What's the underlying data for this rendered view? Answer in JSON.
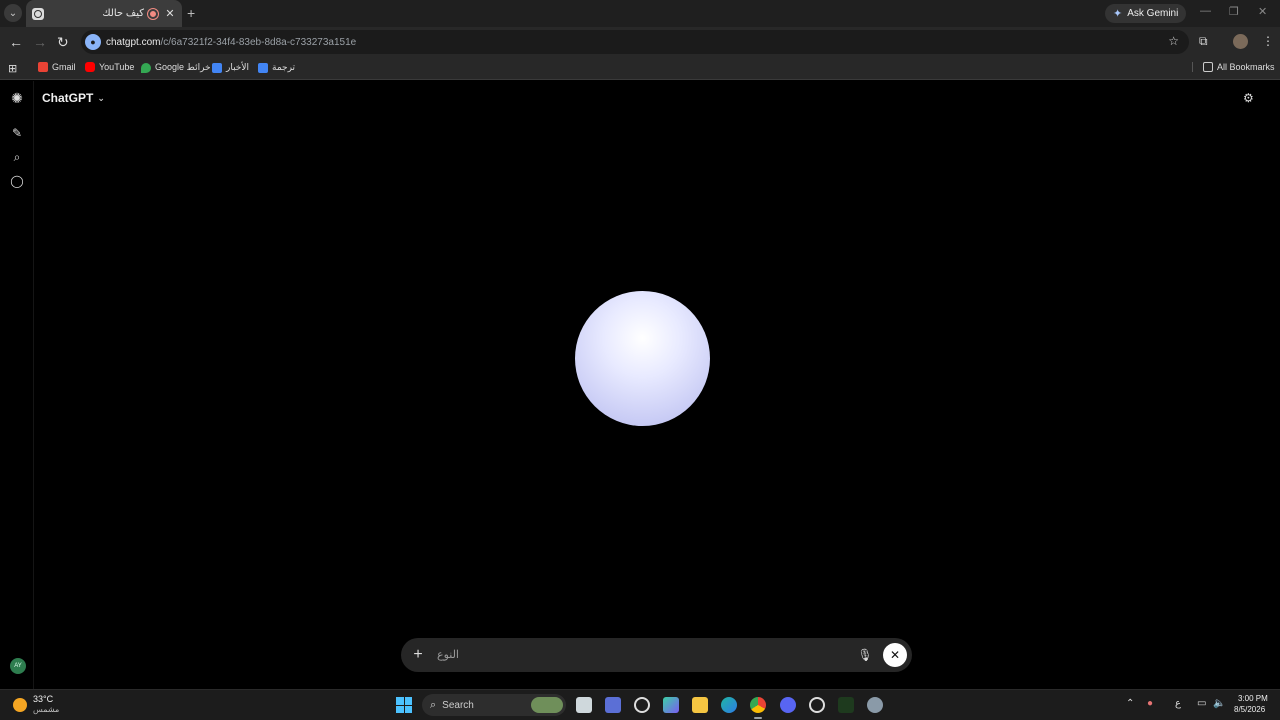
{
  "browser": {
    "tab": {
      "title": "كيف حالك",
      "close": "✕"
    },
    "new_tab": "+",
    "ask_gemini": "Ask Gemini",
    "url_host": "chatgpt.com",
    "url_path": "/c/6a7321f2-34f4-83eb-8d8a-c733273a151e",
    "bookmarks": [
      {
        "label": "Gmail",
        "color": "#ea4335"
      },
      {
        "label": "YouTube",
        "color": "#ff0000"
      },
      {
        "label": "Google خرائط",
        "color": "#34a853"
      },
      {
        "label": "الأخبار",
        "color": "#4285f4"
      },
      {
        "label": "ترجمة",
        "color": "#4285f4"
      }
    ],
    "all_bookmarks": "All Bookmarks"
  },
  "app": {
    "title": "ChatGPT",
    "composer": {
      "placeholder": "النوع"
    },
    "user_initials": "AY",
    "orb_color": "#dfe1fb"
  },
  "taskbar": {
    "weather_temp": "33°C",
    "weather_desc": "مشمس",
    "search_label": "Search",
    "input_lang": "ع",
    "time": "3:00 PM",
    "date": "8/5/2026"
  }
}
